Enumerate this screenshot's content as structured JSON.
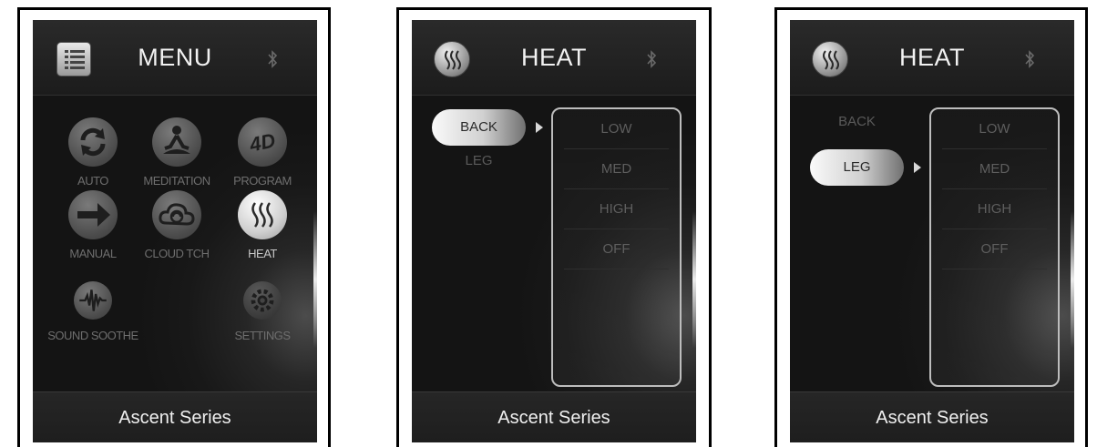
{
  "menu_screen": {
    "title": "MENU",
    "footer": "Ascent Series",
    "items": [
      {
        "label": "AUTO",
        "icon": "auto-refresh-icon",
        "active": false
      },
      {
        "label": "MEDITATION",
        "icon": "meditation-icon",
        "active": false
      },
      {
        "label": "PROGRAM",
        "icon": "4d-icon",
        "active": false
      },
      {
        "label": "MANUAL",
        "icon": "arrow-right-icon",
        "active": false
      },
      {
        "label": "CLOUD TCH",
        "icon": "cloud-touch-icon",
        "active": false
      },
      {
        "label": "HEAT",
        "icon": "heat-waves-icon",
        "active": true
      },
      {
        "label": "SOUND SOOTHE",
        "icon": "sound-wave-icon",
        "active": false
      },
      {
        "label": "SETTINGS",
        "icon": "gear-icon",
        "active": false
      }
    ],
    "icon_4d_text": "4D"
  },
  "heat_back_screen": {
    "title": "HEAT",
    "footer": "Ascent Series",
    "zones": {
      "selected": "BACK",
      "other": "LEG"
    },
    "levels": [
      "LOW",
      "MED",
      "HIGH",
      "OFF"
    ]
  },
  "heat_leg_screen": {
    "title": "HEAT",
    "footer": "Ascent Series",
    "zones": {
      "other": "BACK",
      "selected": "LEG"
    },
    "levels": [
      "LOW",
      "MED",
      "HIGH",
      "OFF"
    ]
  },
  "colors": {
    "screen_bg": "#1a1a1a",
    "text_bright": "#f2f2f2",
    "text_dim": "#6e6e6e",
    "active_highlight": "#e0e0e0"
  }
}
